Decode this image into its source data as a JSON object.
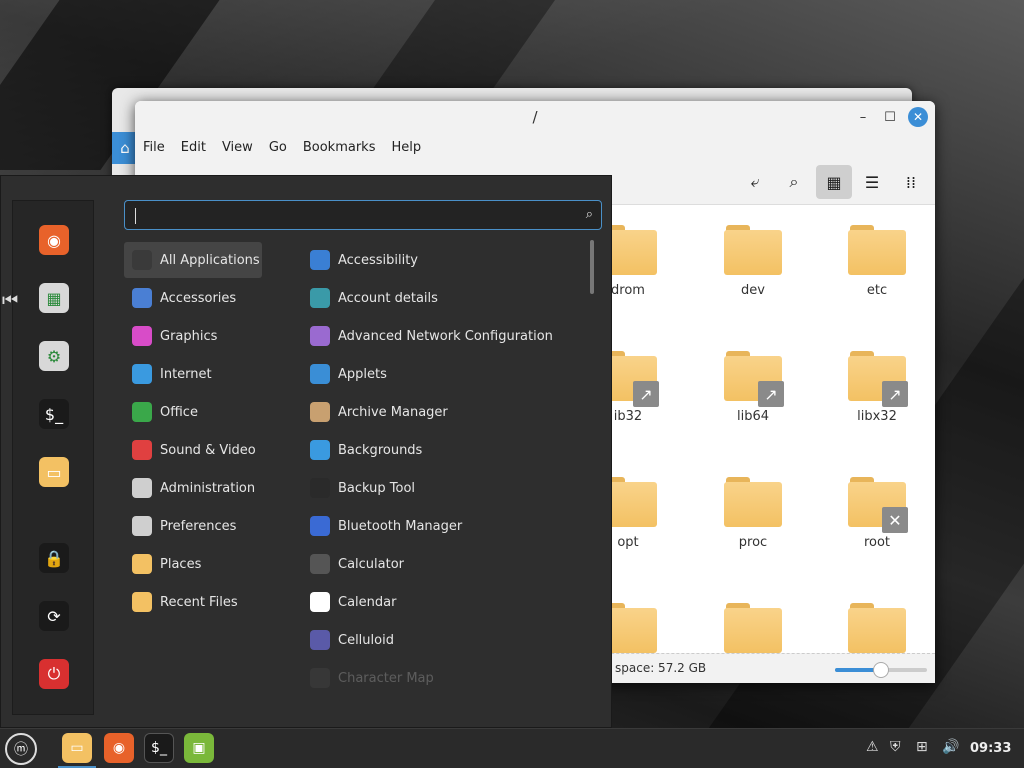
{
  "file_manager": {
    "title": "/",
    "menu": [
      "File",
      "Edit",
      "View",
      "Go",
      "Bookmarks",
      "Help"
    ],
    "folders": [
      {
        "name": "drom",
        "badge": ""
      },
      {
        "name": "dev",
        "badge": ""
      },
      {
        "name": "etc",
        "badge": ""
      },
      {
        "name": "ib32",
        "badge": "link"
      },
      {
        "name": "lib64",
        "badge": "link"
      },
      {
        "name": "libx32",
        "badge": "link"
      },
      {
        "name": "opt",
        "badge": ""
      },
      {
        "name": "proc",
        "badge": ""
      },
      {
        "name": "root",
        "badge": "locked"
      },
      {
        "name": "",
        "badge": ""
      },
      {
        "name": "",
        "badge": ""
      },
      {
        "name": "",
        "badge": ""
      }
    ],
    "status": "space: 57.2 GB",
    "zoom_fraction": 0.5
  },
  "menu": {
    "search_placeholder": "",
    "categories": [
      {
        "label": "All Applications",
        "icon": "grid-icon",
        "color": "#3a3a3a"
      },
      {
        "label": "Accessories",
        "icon": "scissors-icon",
        "color": "#4a7fd4"
      },
      {
        "label": "Graphics",
        "icon": "palette-icon",
        "color": "#d84cc8"
      },
      {
        "label": "Internet",
        "icon": "cloud-icon",
        "color": "#3a9ae0"
      },
      {
        "label": "Office",
        "icon": "document-icon",
        "color": "#3aa84a"
      },
      {
        "label": "Sound & Video",
        "icon": "play-icon",
        "color": "#e04040"
      },
      {
        "label": "Administration",
        "icon": "toggles-icon",
        "color": "#cfcfcf"
      },
      {
        "label": "Preferences",
        "icon": "toggles-icon",
        "color": "#cfcfcf"
      },
      {
        "label": "Places",
        "icon": "folder-icon",
        "color": "#f3c163"
      },
      {
        "label": "Recent Files",
        "icon": "folder-clock-icon",
        "color": "#f3c163"
      }
    ],
    "apps": [
      {
        "label": "Accessibility",
        "icon": "accessibility-icon",
        "color": "#3a7fd4"
      },
      {
        "label": "Account details",
        "icon": "user-icon",
        "color": "#3a9aa8"
      },
      {
        "label": "Advanced Network Configuration",
        "icon": "network-icon",
        "color": "#9a6ad0"
      },
      {
        "label": "Applets",
        "icon": "applets-icon",
        "color": "#3a8ed6"
      },
      {
        "label": "Archive Manager",
        "icon": "archive-icon",
        "color": "#c8a070"
      },
      {
        "label": "Backgrounds",
        "icon": "backgrounds-icon",
        "color": "#3a9ae0"
      },
      {
        "label": "Backup Tool",
        "icon": "backup-icon",
        "color": "#2a2a2a"
      },
      {
        "label": "Bluetooth Manager",
        "icon": "bluetooth-icon",
        "color": "#3a6ad4"
      },
      {
        "label": "Calculator",
        "icon": "calculator-icon",
        "color": "#555555"
      },
      {
        "label": "Calendar",
        "icon": "calendar-icon",
        "color": "#ffffff"
      },
      {
        "label": "Celluloid",
        "icon": "celluloid-icon",
        "color": "#5a5aa8"
      },
      {
        "label": "Character Map",
        "icon": "charmap-icon",
        "color": "#555555"
      }
    ],
    "favorites": [
      {
        "name": "firefox-icon",
        "color": "#e8622a"
      },
      {
        "name": "software-manager-icon",
        "color": "#d8d8d8"
      },
      {
        "name": "settings-icon",
        "color": "#d8d8d8"
      },
      {
        "name": "terminal-icon",
        "color": "#1a1a1a"
      },
      {
        "name": "files-icon",
        "color": "#f3c163"
      },
      {
        "name": "lock-icon",
        "color": "#1a1a1a"
      },
      {
        "name": "logout-icon",
        "color": "#1a1a1a"
      },
      {
        "name": "power-icon",
        "color": "#d83030"
      }
    ]
  },
  "taskbar": {
    "clock": "09:33",
    "apps": [
      "files-icon",
      "firefox-icon",
      "terminal-icon",
      "mintinstall-icon"
    ]
  }
}
